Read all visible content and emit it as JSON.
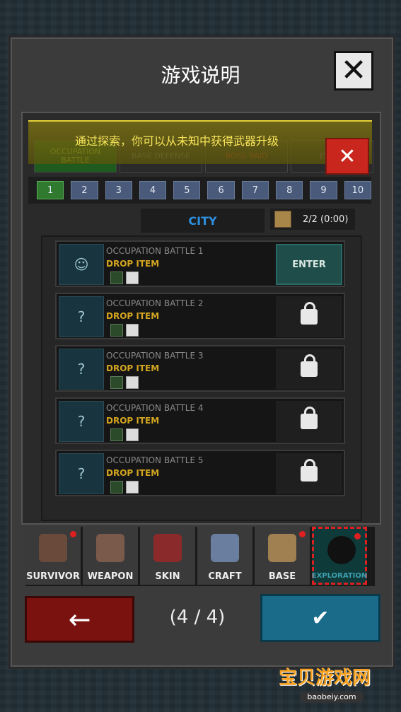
{
  "dialog": {
    "title": "游戏说明",
    "close_icon": "close-icon",
    "page_count": "(4 / 4)"
  },
  "tooltip": {
    "text": "通过探索，你可以从未知中获得武器升级"
  },
  "tabs": [
    {
      "label": "OCCUPATION BATTLE"
    },
    {
      "label": "BASE DEFENSE"
    },
    {
      "label": "BOSS RAID"
    },
    {
      "label": "EVENT"
    }
  ],
  "pages": [
    "1",
    "2",
    "3",
    "4",
    "5",
    "6",
    "7",
    "8",
    "9",
    "10"
  ],
  "location": {
    "name": "CITY",
    "stamina": "2/2 (0:00)"
  },
  "battles": [
    {
      "name": "OCCUPATION BATTLE 1",
      "drop": "DROP ITEM",
      "action": "ENTER",
      "locked": false
    },
    {
      "name": "OCCUPATION BATTLE 2",
      "drop": "DROP ITEM",
      "action": "",
      "locked": true
    },
    {
      "name": "OCCUPATION BATTLE 3",
      "drop": "DROP ITEM",
      "action": "",
      "locked": true
    },
    {
      "name": "OCCUPATION BATTLE 4",
      "drop": "DROP ITEM",
      "action": "",
      "locked": true
    },
    {
      "name": "OCCUPATION BATTLE 5",
      "drop": "DROP ITEM",
      "action": "",
      "locked": true
    }
  ],
  "bottom_nav": [
    {
      "label": "SURVIVOR",
      "icon": "gas-mask-icon"
    },
    {
      "label": "WEAPON",
      "icon": "pistol-icon"
    },
    {
      "label": "SKIN",
      "icon": "jacket-icon"
    },
    {
      "label": "CRAFT",
      "icon": "backpack-icon"
    },
    {
      "label": "BASE",
      "icon": "house-icon"
    },
    {
      "label": "EXPLORATION",
      "icon": "binoculars-icon"
    }
  ],
  "watermark": {
    "title": "宝贝游戏网",
    "url": "baobeiy.com"
  }
}
